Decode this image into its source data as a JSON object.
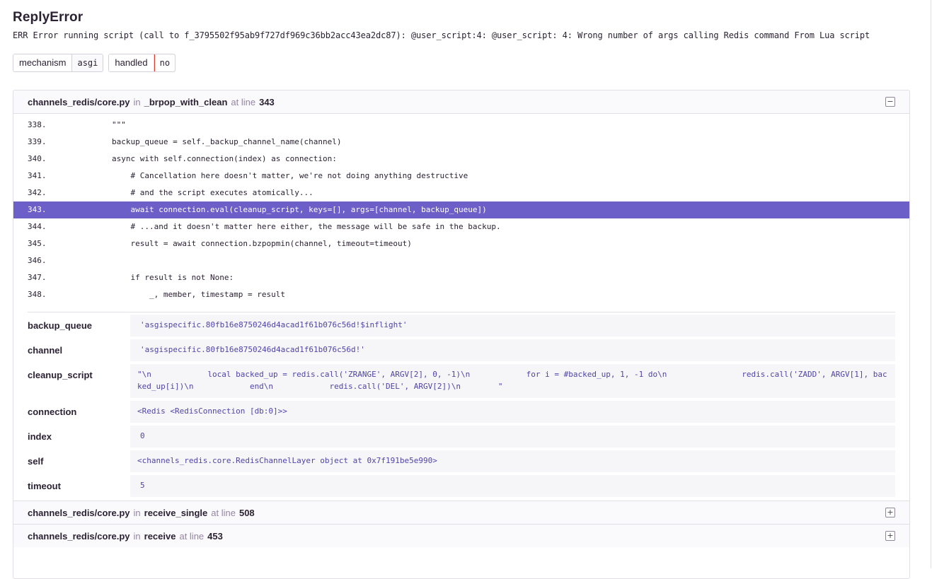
{
  "exception": {
    "type": "ReplyError",
    "message": "ERR Error running script (call to f_3795502f95ab9f727df969c36bb2acc43ea2dc87): @user_script:4: @user_script: 4: Wrong number of args calling Redis command From Lua script"
  },
  "tags": [
    {
      "key": "mechanism",
      "value": "asgi"
    },
    {
      "key": "handled",
      "value": "no"
    }
  ],
  "frames": [
    {
      "file": "channels_redis/core.py",
      "in_label": "in",
      "function": "_brpop_with_clean",
      "at_line_label": "at line",
      "line": "343",
      "toggle": "−",
      "code": [
        {
          "ln": "338.",
          "src": "        \"\"\""
        },
        {
          "ln": "339.",
          "src": "        backup_queue = self._backup_channel_name(channel)"
        },
        {
          "ln": "340.",
          "src": "        async with self.connection(index) as connection:"
        },
        {
          "ln": "341.",
          "src": "            # Cancellation here doesn't matter, we're not doing anything destructive"
        },
        {
          "ln": "342.",
          "src": "            # and the script executes atomically..."
        },
        {
          "ln": "343.",
          "src": "            await connection.eval(cleanup_script, keys=[], args=[channel, backup_queue])"
        },
        {
          "ln": "344.",
          "src": "            # ...and it doesn't matter here either, the message will be safe in the backup."
        },
        {
          "ln": "345.",
          "src": "            result = await connection.bzpopmin(channel, timeout=timeout)"
        },
        {
          "ln": "346.",
          "src": ""
        },
        {
          "ln": "347.",
          "src": "            if result is not None:"
        },
        {
          "ln": "348.",
          "src": "                _, member, timestamp = result"
        }
      ],
      "vars": [
        {
          "name": "backup_queue",
          "value": "'asgispecific.80fb16e8750246d4acad1f61b076c56d!$inflight'"
        },
        {
          "name": "channel",
          "value": "'asgispecific.80fb16e8750246d4acad1f61b076c56d!'"
        },
        {
          "name": "cleanup_script",
          "value": "\"\\n            local backed_up = redis.call('ZRANGE', ARGV[2], 0, -1)\\n            for i = #backed_up, 1, -1 do\\n                redis.call('ZADD', ARGV[1], backed_up[i])\\n            end\\n            redis.call('DEL', ARGV[2])\\n        \""
        },
        {
          "name": "connection",
          "value": "<Redis <RedisConnection [db:0]>>"
        },
        {
          "name": "index",
          "value": "0"
        },
        {
          "name": "self",
          "value": "<channels_redis.core.RedisChannelLayer object at 0x7f191be5e990>"
        },
        {
          "name": "timeout",
          "value": "5"
        }
      ]
    },
    {
      "file": "channels_redis/core.py",
      "in_label": "in",
      "function": "receive_single",
      "at_line_label": "at line",
      "line": "508",
      "toggle": "+"
    },
    {
      "file": "channels_redis/core.py",
      "in_label": "in",
      "function": "receive",
      "at_line_label": "at line",
      "line": "453",
      "toggle": "+"
    }
  ]
}
